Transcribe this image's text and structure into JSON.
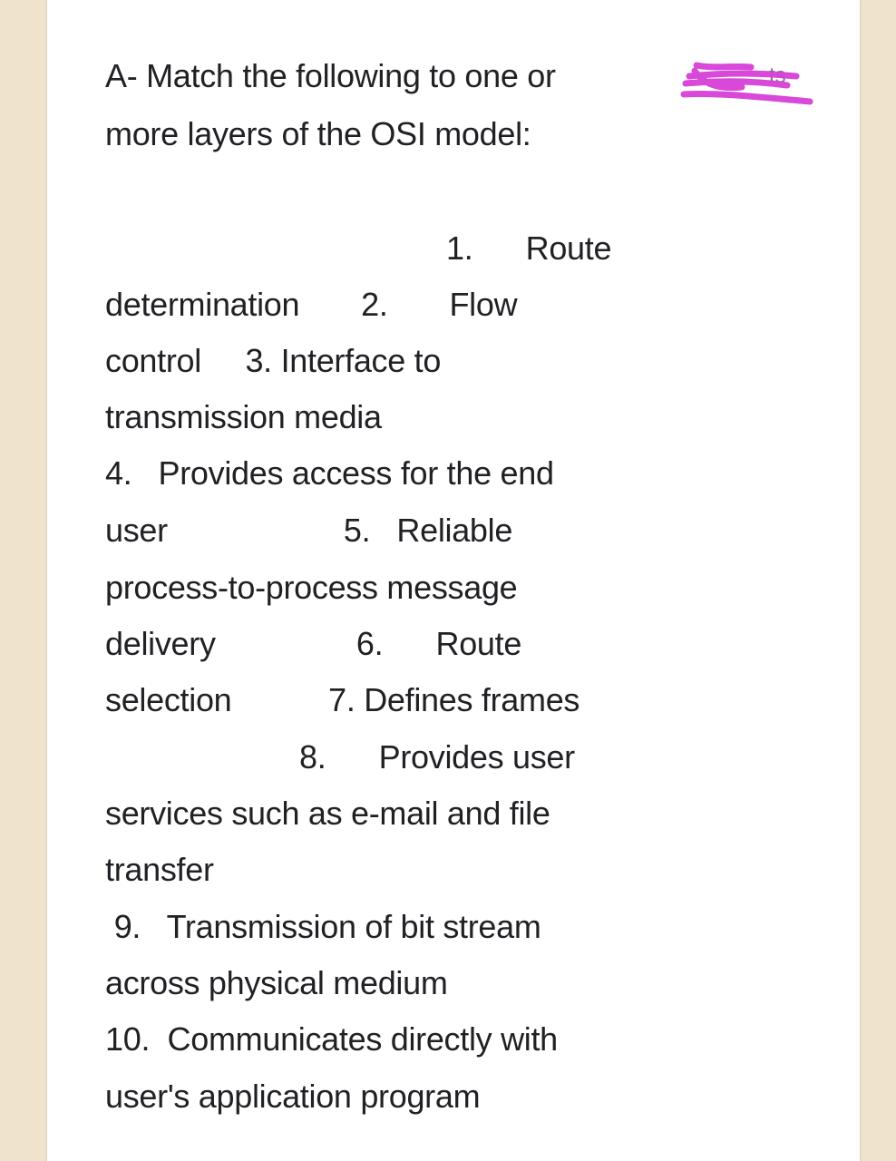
{
  "question": {
    "title_line1": "A- Match the following to one or",
    "title_line2": "more layers of the OSI model:",
    "redacted_word_suffix": "ts",
    "redaction_color": "#d63fd8"
  },
  "lines": [
    {
      "text": "1.      Route"
    },
    {
      "text": "determination       2.       Flow"
    },
    {
      "text": "control     3. Interface to"
    },
    {
      "text": "transmission media"
    },
    {
      "text": "4.   Provides access for the end"
    },
    {
      "text": "user                    5.   Reliable"
    },
    {
      "text": "process-to-process message"
    },
    {
      "text": "delivery                6.      Route"
    },
    {
      "text": "selection           7. Defines frames"
    },
    {
      "text": "8.      Provides user"
    },
    {
      "text": "services such as e-mail and file"
    },
    {
      "text": "transfer"
    },
    {
      "text": " 9.   Transmission of bit stream"
    },
    {
      "text": "across physical medium"
    },
    {
      "text": "10.  Communicates directly with"
    },
    {
      "text": "user's application program"
    }
  ],
  "items": [
    {
      "number": "1",
      "text": "Route determination"
    },
    {
      "number": "2",
      "text": "Flow control"
    },
    {
      "number": "3",
      "text": "Interface to transmission media"
    },
    {
      "number": "4",
      "text": "Provides access for the end user"
    },
    {
      "number": "5",
      "text": "Reliable process-to-process message delivery"
    },
    {
      "number": "6",
      "text": "Route selection"
    },
    {
      "number": "7",
      "text": "Defines frames"
    },
    {
      "number": "8",
      "text": "Provides user services such as e-mail and file transfer"
    },
    {
      "number": "9",
      "text": "Transmission of bit stream across physical medium"
    },
    {
      "number": "10",
      "text": "Communicates directly with user's application program"
    }
  ]
}
